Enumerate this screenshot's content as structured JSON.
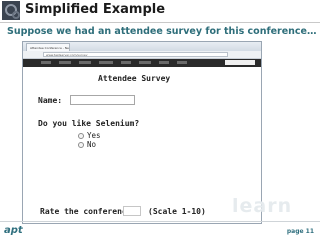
{
  "slide": {
    "title": "Simplified Example",
    "subtitle": "Suppose we had an attendee survey for this conference…",
    "page_label": "page 11",
    "footer_logo": "apt",
    "watermark": "learn"
  },
  "browser": {
    "tab_title": "Attendee Conference - Ne...",
    "address": "www.testserver.com/survey"
  },
  "survey": {
    "title": "Attendee Survey",
    "name_label": "Name:",
    "name_value": "",
    "question": "Do you like Selenium?",
    "options": [
      "Yes",
      "No"
    ],
    "rating_label": "Rate the conference:",
    "rating_value": "",
    "scale_label": "(Scale 1-10)"
  },
  "colors": {
    "subtitle": "#2e6e7a",
    "footer": "#2f6f7e",
    "navbar": "#2a2a2a"
  }
}
